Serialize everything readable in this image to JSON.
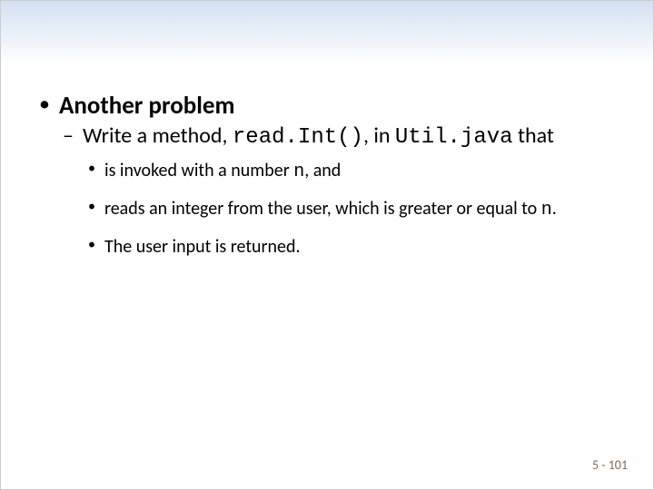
{
  "bullets": {
    "title": "Another problem",
    "sub": {
      "pre": "Write a method, ",
      "code1": "read.Int()",
      "mid": ", in ",
      "code2": "Util.java",
      "post": " that"
    },
    "items": {
      "a_pre": "is invoked with a number ",
      "a_code": "n",
      "a_post": ", and",
      "b_pre": "reads an integer from the user, which is greater or equal to ",
      "b_code": "n",
      "b_post": ".",
      "c": "The user input is returned."
    }
  },
  "footer": "5 - 101"
}
